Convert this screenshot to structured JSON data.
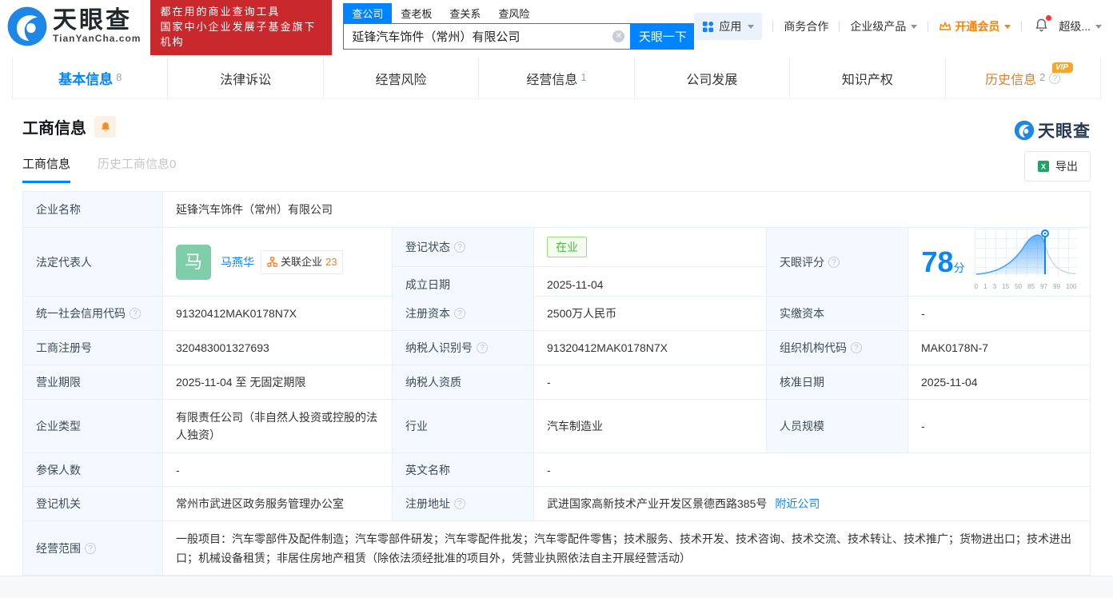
{
  "header": {
    "logo": {
      "title": "天眼查",
      "domain": "TianYanCha.com"
    },
    "slogan": {
      "line1": "都在用的商业查询工具",
      "line2": "国家中小企业发展子基金旗下机构"
    },
    "search": {
      "tabs": [
        {
          "label": "查公司"
        },
        {
          "label": "查老板"
        },
        {
          "label": "查关系"
        },
        {
          "label": "查风险"
        }
      ],
      "value": "延锋汽车饰件（常州）有限公司",
      "button": "天眼一下"
    },
    "menu": {
      "apps": "应用",
      "cooperation": "商务合作",
      "enterprise": "企业级产品",
      "vip": "开通会员",
      "super": "超级..."
    }
  },
  "nav_tabs": [
    {
      "label": "基本信息",
      "count": "8"
    },
    {
      "label": "法律诉讼",
      "count": ""
    },
    {
      "label": "经营风险",
      "count": ""
    },
    {
      "label": "经营信息",
      "count": "1"
    },
    {
      "label": "公司发展",
      "count": ""
    },
    {
      "label": "知识产权",
      "count": ""
    },
    {
      "label": "历史信息",
      "count": "2",
      "vip": "VIP"
    }
  ],
  "section": {
    "title": "工商信息",
    "watermark": "天眼查",
    "export_label": "导出",
    "subtabs": [
      {
        "label": "工商信息"
      },
      {
        "label": "历史工商信息0"
      }
    ]
  },
  "fields": {
    "company_name": {
      "label": "企业名称",
      "value": "延锋汽车饰件（常州）有限公司"
    },
    "legal_rep": {
      "label": "法定代表人",
      "avatar_char": "马",
      "name": "马燕华",
      "related_label": "关联企业",
      "related_count": "23"
    },
    "reg_status": {
      "label": "登记状态",
      "value": "在业"
    },
    "establish_date": {
      "label": "成立日期",
      "value": "2025-11-04"
    },
    "score": {
      "label": "天眼评分",
      "value": "78",
      "unit": "分"
    },
    "credit_code": {
      "label": "统一社会信用代码",
      "value": "91320412MAK0178N7X"
    },
    "reg_capital": {
      "label": "注册资本",
      "value": "2500万人民币"
    },
    "paid_capital": {
      "label": "实缴资本",
      "value": "-"
    },
    "reg_number": {
      "label": "工商注册号",
      "value": "320483001327693"
    },
    "taxpayer_id": {
      "label": "纳税人识别号",
      "value": "91320412MAK0178N7X"
    },
    "org_code": {
      "label": "组织机构代码",
      "value": "MAK0178N-7"
    },
    "business_term": {
      "label": "营业期限",
      "value": "2025-11-04 至 无固定期限"
    },
    "taxpayer_quality": {
      "label": "纳税人资质",
      "value": "-"
    },
    "approval_date": {
      "label": "核准日期",
      "value": "2025-11-04"
    },
    "company_type": {
      "label": "企业类型",
      "value": "有限责任公司（非自然人投资或控股的法人独资）"
    },
    "industry": {
      "label": "行业",
      "value": "汽车制造业"
    },
    "staff_size": {
      "label": "人员规模",
      "value": "-"
    },
    "insured_count": {
      "label": "参保人数",
      "value": "-"
    },
    "english_name": {
      "label": "英文名称",
      "value": "-"
    },
    "reg_authority": {
      "label": "登记机关",
      "value": "常州市武进区政务服务管理办公室"
    },
    "reg_address": {
      "label": "注册地址",
      "value": "武进国家高新技术产业开发区景德西路385号",
      "nearby_link": "附近公司"
    },
    "business_scope": {
      "label": "经营范围",
      "value": "一般项目：汽车零部件及配件制造；汽车零部件研发；汽车零配件批发；汽车零配件零售；技术服务、技术开发、技术咨询、技术交流、技术转让、技术推广；货物进出口；技术进出口；机械设备租赁；非居住房地产租赁（除依法须经批准的项目外，凭营业执照依法自主开展经营活动）"
    }
  },
  "chart_data": {
    "type": "area",
    "title": "天眼评分分布曲线",
    "score": 78,
    "x_tick_labels": [
      "0",
      "1",
      "3",
      "15",
      "50",
      "85",
      "97",
      "99",
      "100"
    ],
    "marker_at_label": "85",
    "accent_color": "#0b84ff"
  },
  "colors": {
    "brand_blue": "#0084ff",
    "vip_orange": "#ff8000",
    "status_green": "#49bc3c",
    "badge_red": "#c9282d"
  }
}
